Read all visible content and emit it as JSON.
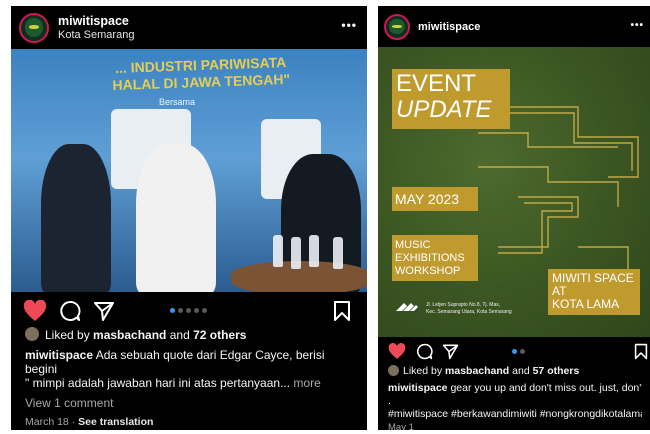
{
  "post_left": {
    "username": "miwitispace",
    "location": "Kota Semarang",
    "more_label": "•••",
    "photo": {
      "banner_line1": "... INDUSTRI PARIWISATA",
      "banner_line2": "HALAL DI JAWA TENGAH\"",
      "banner_sub": "Bersama"
    },
    "likes": {
      "prefix": "Liked by ",
      "user": "masbachand",
      "mid": " and ",
      "count": "72 others"
    },
    "caption": {
      "user": "miwitispace",
      "line1": "Ada sebuah quote dari Edgar Cayce, berisi",
      "line2": "begini",
      "line3": "\" mimpi adalah jawaban hari ini atas pertanyaan...",
      "more": "more"
    },
    "comments_link": "View 1 comment",
    "date": "March 18",
    "separator": "·",
    "translate_link": "See translation",
    "carousel": {
      "count": 5,
      "active": 0
    }
  },
  "post_right": {
    "username": "miwitispace",
    "more_label": "•••",
    "graphic": {
      "event": "EVENT",
      "update": "UPDATE",
      "month": "MAY 2023",
      "activities": [
        "MUSIC",
        "EXHIBITIONS",
        "WORKSHOP"
      ],
      "venue": [
        "MIWITI SPACE",
        "AT",
        "KOTA LAMA"
      ],
      "address": [
        "Jl. Letjen Suprapto No.8, Tj. Mas,",
        "Kec. Semarang Utara, Kota Semarang"
      ]
    },
    "likes": {
      "prefix": "Liked by ",
      "user": "masbachand",
      "mid": " and ",
      "count": "57 others"
    },
    "caption": {
      "user": "miwitispace",
      "line1": "gear you up and don't miss out. just, don't",
      "line2": ".",
      "line3": "#miwitispace #berkawandimiwiti #nongkrongdikotalama"
    },
    "date": "May 1",
    "carousel": {
      "count": 2,
      "active": 0
    }
  },
  "colors": {
    "accent_blue": "#3897f0",
    "like_red": "#ed4956",
    "gold": "#bf9a2f"
  }
}
